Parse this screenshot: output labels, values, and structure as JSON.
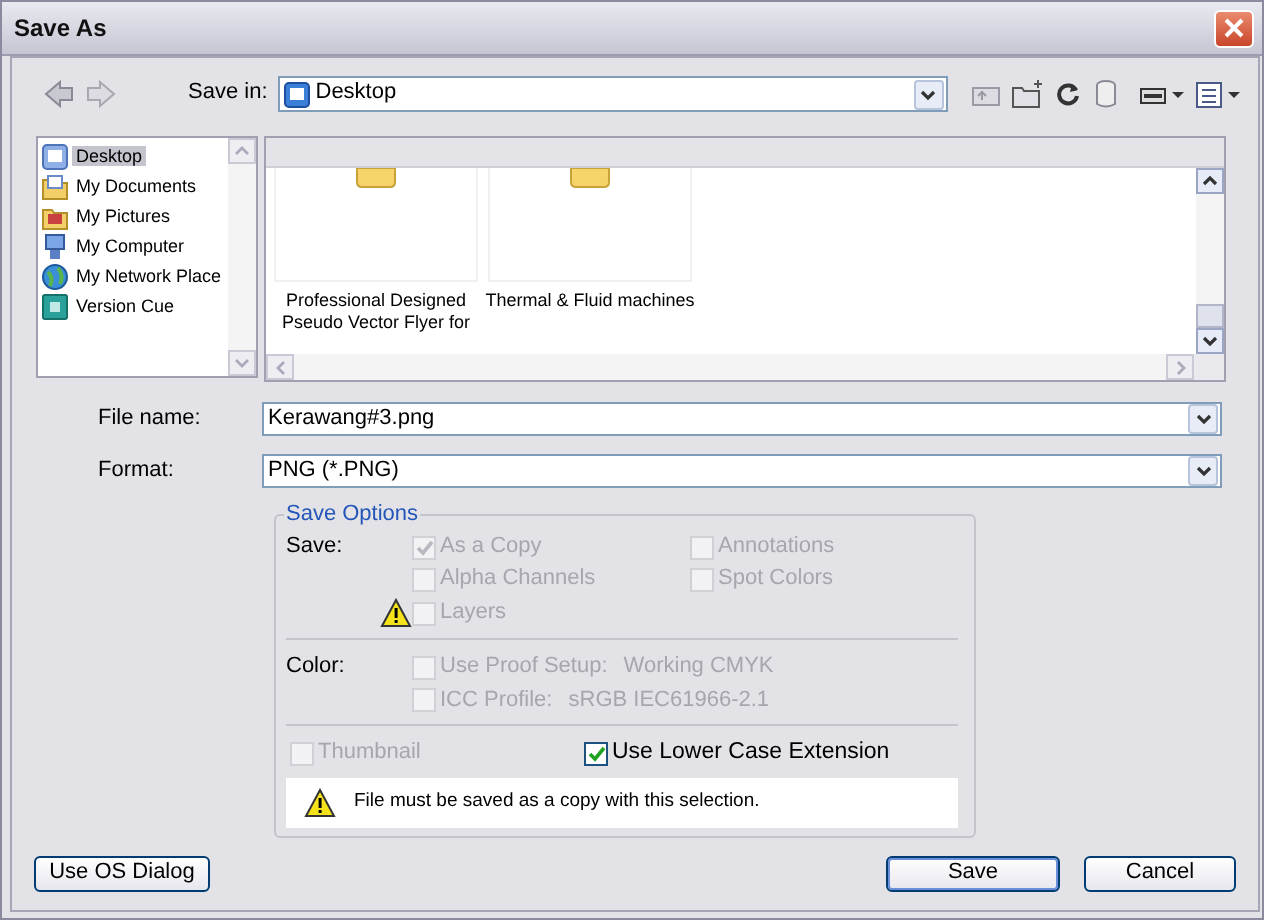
{
  "window": {
    "title": "Save As"
  },
  "toolbar": {
    "save_in_label": "Save in:",
    "location": "Desktop"
  },
  "places": [
    {
      "label": "Desktop",
      "kind": "desktop",
      "selected": true
    },
    {
      "label": "My Documents",
      "kind": "documents",
      "selected": false
    },
    {
      "label": "My Pictures",
      "kind": "pictures",
      "selected": false
    },
    {
      "label": "My Computer",
      "kind": "computer",
      "selected": false
    },
    {
      "label": "My Network Place",
      "kind": "network",
      "selected": false
    },
    {
      "label": "Version Cue",
      "kind": "versioncue",
      "selected": false
    }
  ],
  "files": [
    {
      "name": "Professional Designed\nPseudo Vector Flyer for"
    },
    {
      "name": "Thermal & Fluid machines"
    }
  ],
  "file_name": {
    "label": "File name:",
    "value": "Kerawang#3.png"
  },
  "format": {
    "label": "Format:",
    "value": "PNG (*.PNG)"
  },
  "save_options": {
    "legend": "Save Options",
    "save_group": {
      "label": "Save:",
      "columns": [
        [
          {
            "label": "As a Copy",
            "checked": true,
            "disabled": true,
            "warning": false
          },
          {
            "label": "Alpha Channels",
            "checked": false,
            "disabled": true,
            "warning": false
          },
          {
            "label": "Layers",
            "checked": false,
            "disabled": true,
            "warning": true
          }
        ],
        [
          {
            "label": "Annotations",
            "checked": false,
            "disabled": true,
            "warning": false
          },
          {
            "label": "Spot Colors",
            "checked": false,
            "disabled": true,
            "warning": false
          }
        ]
      ]
    },
    "color_group": {
      "label": "Color:",
      "options": [
        {
          "label": "Use Proof Setup:",
          "value": "Working CMYK",
          "checked": false,
          "disabled": true
        },
        {
          "label": "ICC Profile:",
          "value": "sRGB IEC61966-2.1",
          "checked": false,
          "disabled": true
        }
      ]
    },
    "extras": [
      {
        "label": "Thumbnail",
        "checked": false,
        "disabled": true
      },
      {
        "label": "Use Lower Case Extension",
        "checked": true,
        "disabled": false
      }
    ],
    "message": "File must be saved as a copy with this selection."
  },
  "buttons": [
    {
      "label": "Use OS Dialog",
      "default": false
    },
    {
      "label": "Save",
      "default": true
    },
    {
      "label": "Cancel",
      "default": false
    }
  ]
}
